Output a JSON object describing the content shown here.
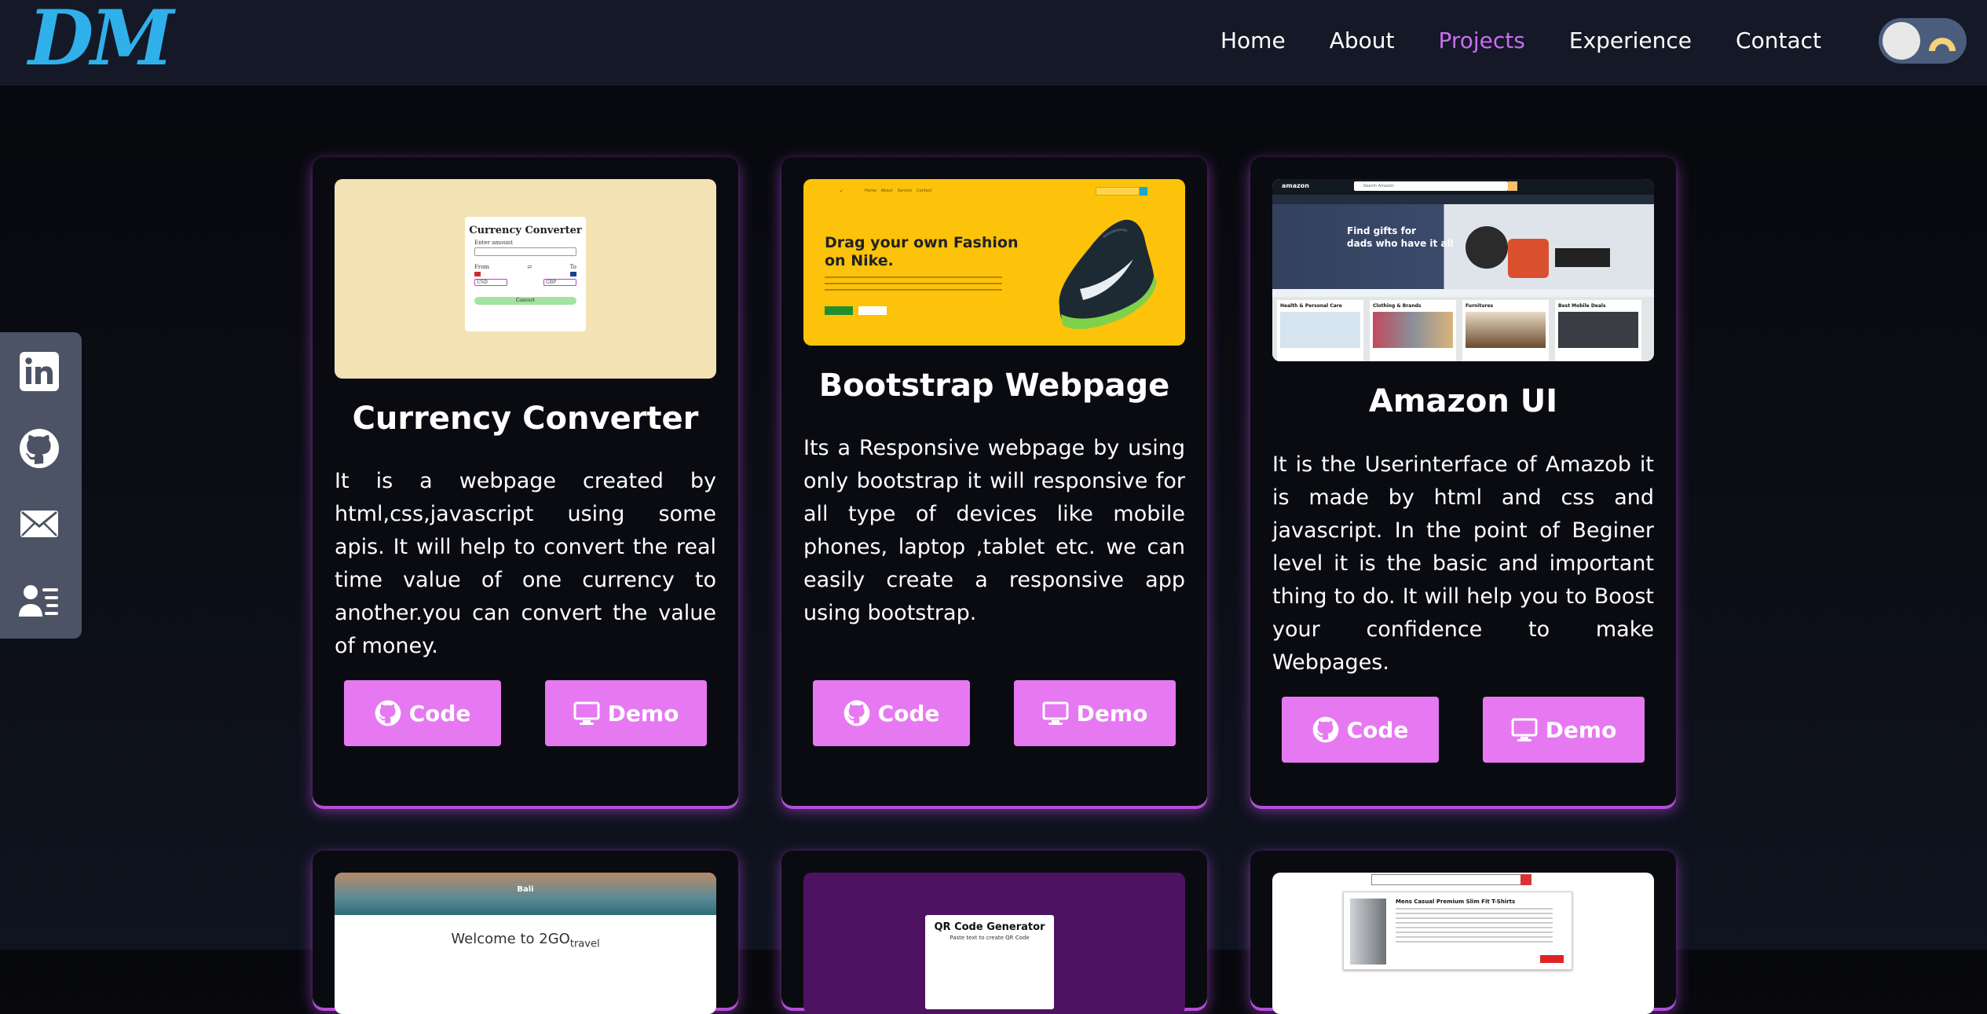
{
  "header": {
    "logo": "DM",
    "nav": [
      "Home",
      "About",
      "Projects",
      "Experience",
      "Contact"
    ],
    "active_nav": "Projects",
    "theme_toggle": "dark"
  },
  "social": {
    "icons": [
      "linkedin-icon",
      "github-icon",
      "mail-icon",
      "contact-card-icon"
    ]
  },
  "projects": [
    {
      "title": "Currency Converter",
      "description": "It is a webpage created by html,css,javascript using some apis. It will help to convert the real time value of one currency to another.you can convert the value of money.",
      "code_label": "Code",
      "demo_label": "Demo",
      "thumb": {
        "heading": "Currency Converter",
        "amount_label": "Enter amount",
        "from_label": "From",
        "to_label": "To",
        "from_value": "USD",
        "to_value": "GBP",
        "button": "Convert"
      }
    },
    {
      "title": "Bootstrap Webpage",
      "description": "Its a Responsive webpage by using only bootstrap it will responsive for all type of devices like mobile phones, laptop ,tablet etc. we can easily create a responsive app using bootstrap.",
      "code_label": "Code",
      "demo_label": "Demo",
      "thumb": {
        "headline_1": "Drag your own Fashion",
        "headline_2": "on Nike.",
        "nav": [
          "Home",
          "About",
          "Service",
          "Contact"
        ]
      }
    },
    {
      "title": "Amazon UI",
      "description": "It is the Userinterface of Amazob it is made by html and css and javascript. In the point of Beginer level it is the basic and important thing to do. It will help you to Boost your confidence to make Webpages.",
      "code_label": "Code",
      "demo_label": "Demo",
      "thumb": {
        "brand": "amazon",
        "search_placeholder": "Search Amazon",
        "hero_1": "Find gifts for",
        "hero_2": "dads who have it all",
        "tiles": [
          "Health & Personal Care",
          "Clothing & Brands",
          "Furnitures",
          "Best Mobile Deals"
        ]
      }
    }
  ],
  "next_row": [
    {
      "thumb_title": "Bali",
      "thumb_welcome": "Welcome to 2GO",
      "thumb_welcome_sub": "travel"
    },
    {
      "thumb_title": "QR Code Generator",
      "thumb_sub": "Paste text to create QR Code"
    },
    {
      "thumb_title": "Mens Casual Premium Slim Fit T-Shirts"
    }
  ],
  "colors": {
    "accent": "#e679f2",
    "nav_active": "#c86df2",
    "logo": "#2fb0ea",
    "header_bg": "#151826",
    "card_bg": "#0a0b10"
  }
}
